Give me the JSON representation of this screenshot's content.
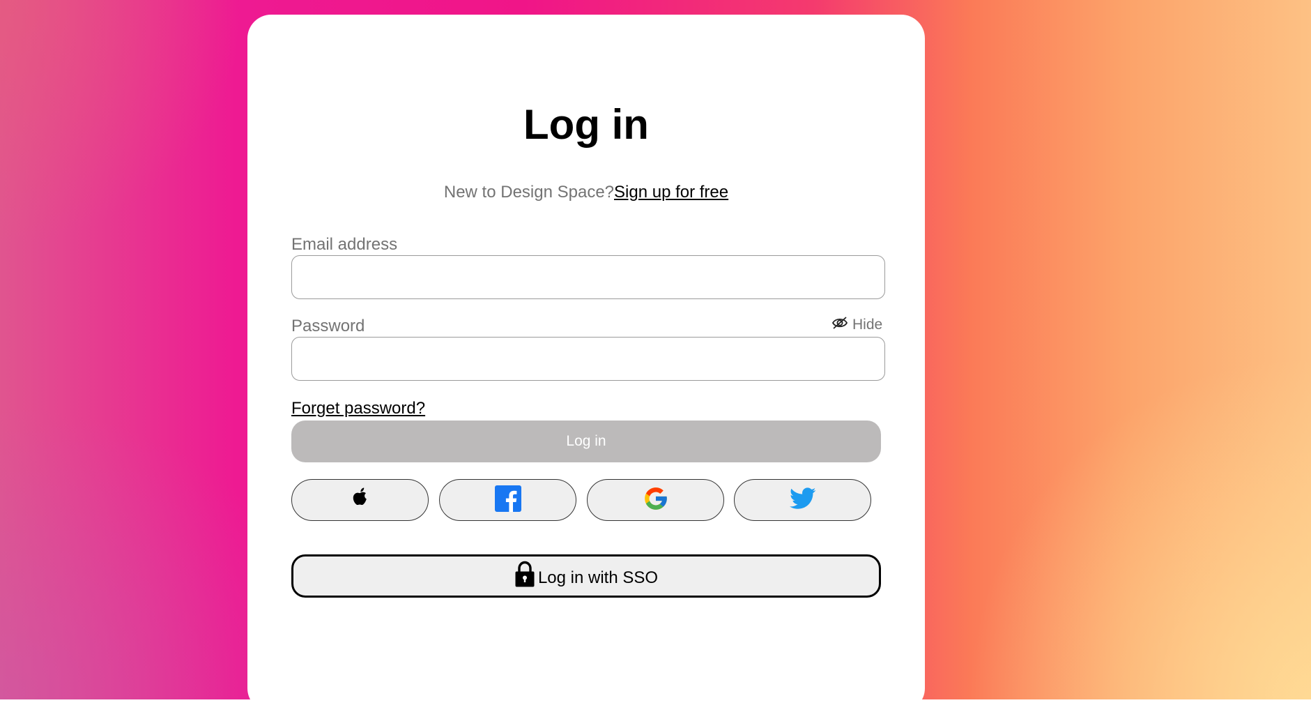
{
  "page": {
    "title": "Log in",
    "signup_prompt": "New to Design Space?",
    "signup_link": "Sign up for free"
  },
  "form": {
    "email_label": "Email address",
    "email_value": "",
    "password_label": "Password",
    "password_value": "",
    "hide_label": "Hide",
    "forget_link": "Forget password?",
    "login_button": "Log in"
  },
  "social": [
    {
      "name": "apple",
      "icon": "apple-icon"
    },
    {
      "name": "facebook",
      "icon": "facebook-icon"
    },
    {
      "name": "google",
      "icon": "google-icon"
    },
    {
      "name": "twitter",
      "icon": "twitter-icon"
    }
  ],
  "sso": {
    "label": "Log in with SSO",
    "icon": "lock-icon"
  },
  "colors": {
    "card_background": "#ffffff",
    "login_button_disabled": "#bcbaba",
    "muted_text": "#737373",
    "facebook_blue": "#1877f2",
    "twitter_blue": "#1d9bf0",
    "gradient_pink": "#f01588",
    "gradient_orange": "#fca36a"
  }
}
